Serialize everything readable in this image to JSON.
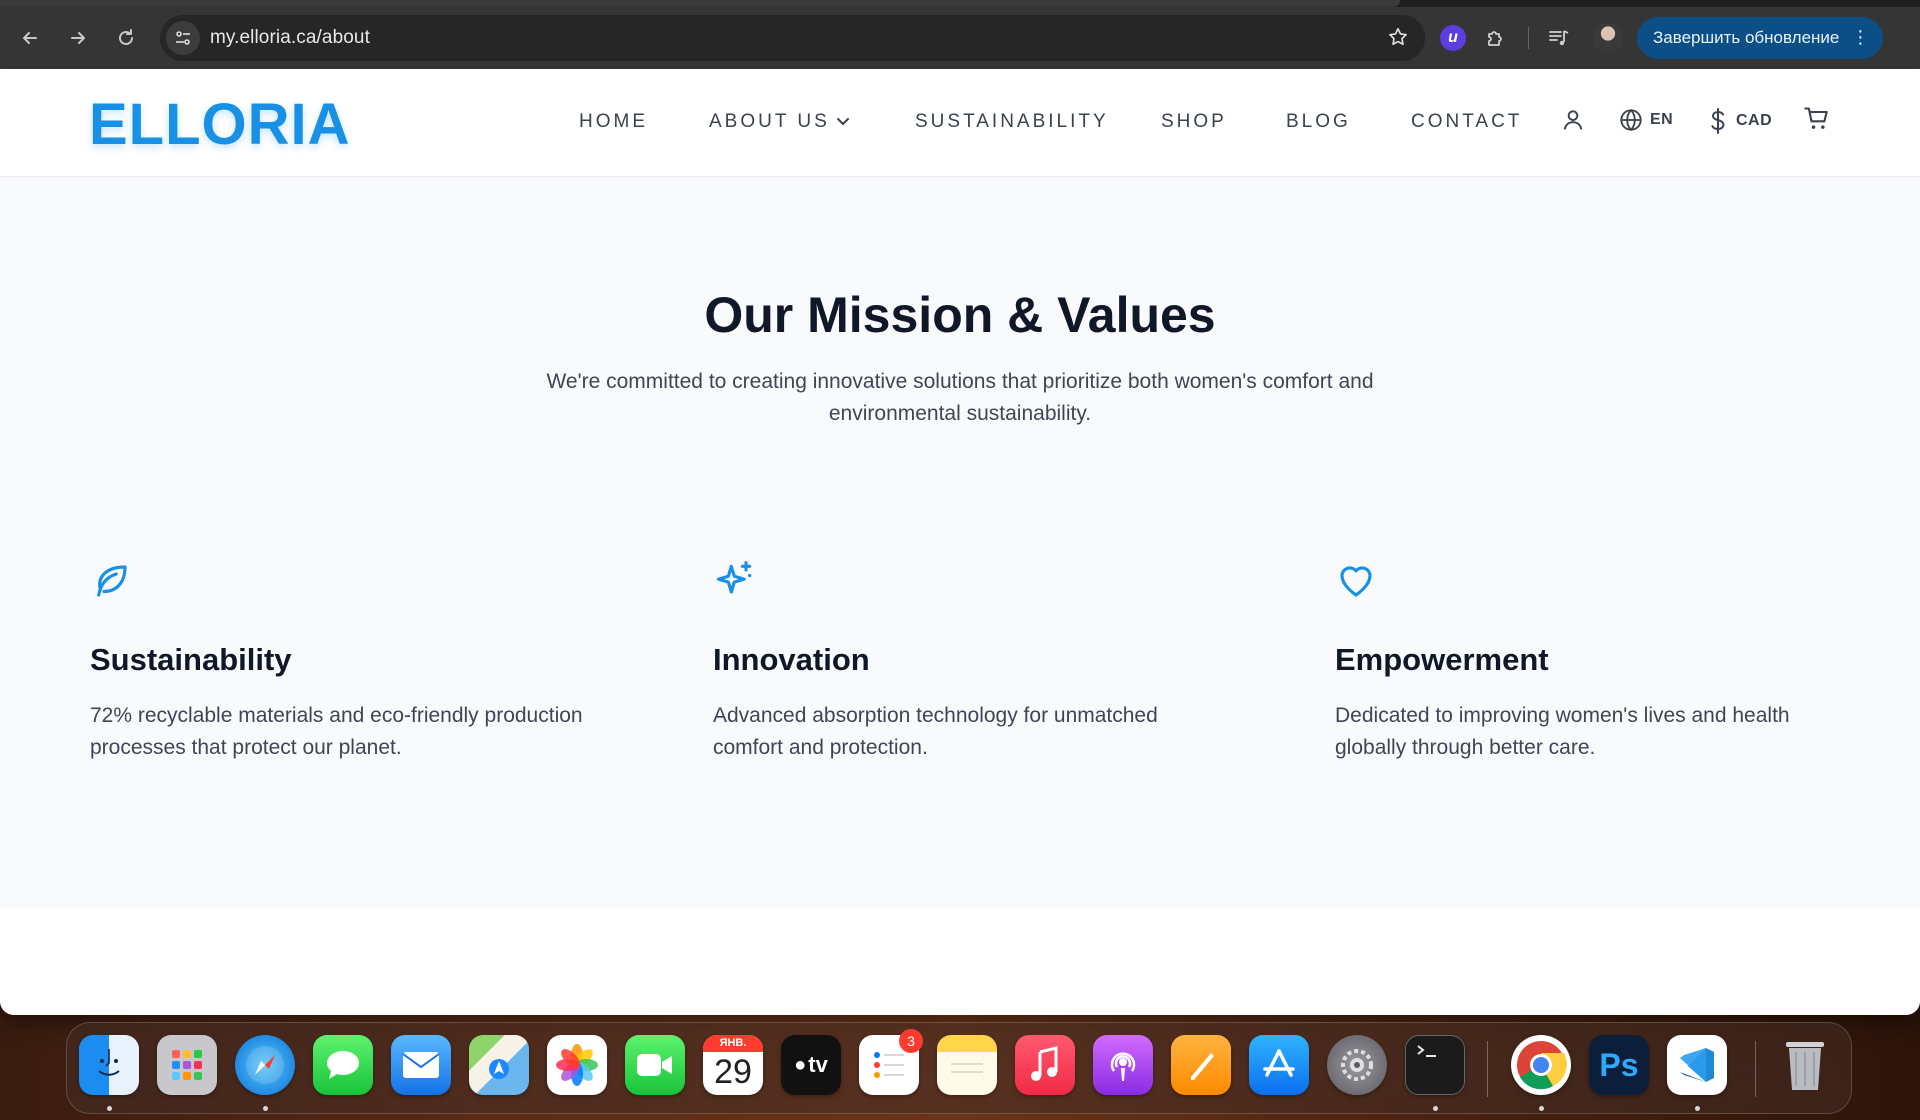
{
  "browser": {
    "url_host": "my.elloria.ca",
    "url_path": "/about",
    "update_label": "Завершить обновление",
    "extension_letter": "u"
  },
  "site": {
    "logo": "ELLORIA",
    "nav": {
      "home": "HOME",
      "about": "ABOUT US",
      "sustainability": "SUSTAINABILITY",
      "shop": "SHOP",
      "blog": "BLOG",
      "contact": "CONTACT"
    },
    "language": "EN",
    "currency": "CAD",
    "accent_color": "#1790e6"
  },
  "mission": {
    "title": "Our Mission & Values",
    "subtitle": "We're committed to creating innovative solutions that prioritize both women's comfort and environmental sustainability.",
    "values": [
      {
        "icon": "leaf-icon",
        "title": "Sustainability",
        "description": "72% recyclable materials and eco-friendly production processes that protect our planet."
      },
      {
        "icon": "sparkles-icon",
        "title": "Innovation",
        "description": "Advanced absorption technology for unmatched comfort and protection."
      },
      {
        "icon": "heart-icon",
        "title": "Empowerment",
        "description": "Dedicated to improving women's lives and health globally through better care."
      }
    ]
  },
  "dock": {
    "calendar_month": "ЯНВ.",
    "calendar_day": "29",
    "reminders_badge": "3",
    "tv_label": "tv",
    "ps_label": "Ps",
    "apps": [
      "finder-icon",
      "launchpad-icon",
      "safari-icon",
      "messages-icon",
      "mail-icon",
      "maps-icon",
      "photos-icon",
      "facetime-icon",
      "calendar-icon",
      "apple-tv-icon",
      "reminders-icon",
      "notes-icon",
      "music-icon",
      "podcasts-icon",
      "pages-icon",
      "app-store-icon",
      "system-settings-icon",
      "terminal-icon",
      "chrome-icon",
      "photoshop-icon",
      "vscode-icon",
      "trash-icon"
    ]
  }
}
